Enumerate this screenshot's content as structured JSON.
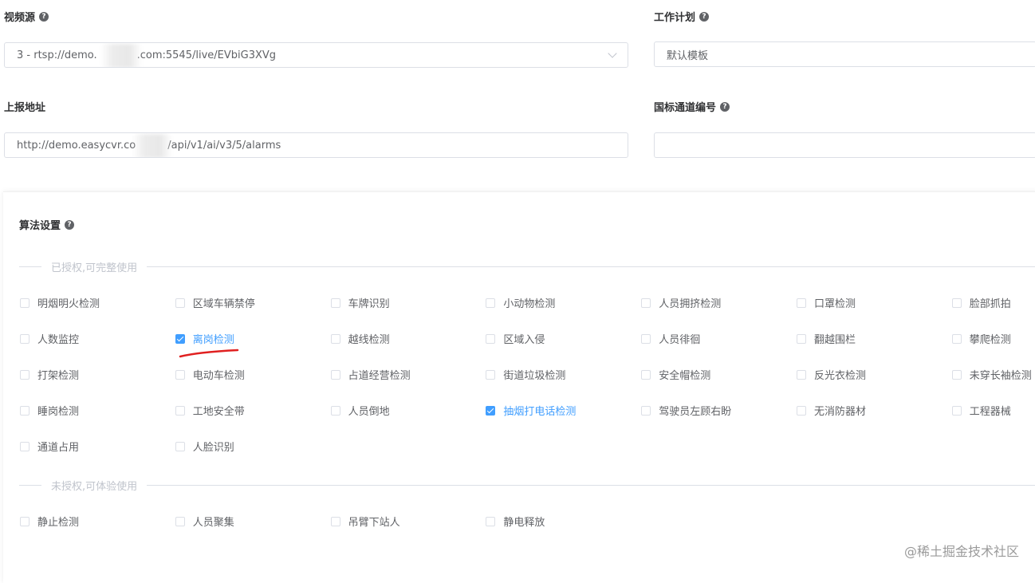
{
  "form": {
    "video_source": {
      "label": "视频源",
      "value_prefix": "3 - rtsp://demo.",
      "value_suffix": ".com:5545/live/EVbiG3XVg"
    },
    "work_plan": {
      "label": "工作计划",
      "value": "默认模板"
    },
    "report_url": {
      "label": "上报地址",
      "value_prefix": "http://demo.easycvr.co",
      "value_suffix": "/api/v1/ai/v3/5/alarms"
    },
    "gb_channel_id": {
      "label": "国标通道编号",
      "value": ""
    },
    "help_glyph": "?"
  },
  "algorithm": {
    "title": "算法设置",
    "authorized_title": "已授权,可完整使用",
    "unauthorized_title": "未授权,可体验使用",
    "authorized": [
      {
        "label": "明烟明火检测",
        "checked": false
      },
      {
        "label": "区域车辆禁停",
        "checked": false
      },
      {
        "label": "车牌识别",
        "checked": false
      },
      {
        "label": "小动物检测",
        "checked": false
      },
      {
        "label": "人员拥挤检测",
        "checked": false
      },
      {
        "label": "口罩检测",
        "checked": false
      },
      {
        "label": "脸部抓拍",
        "checked": false
      },
      {
        "label": "人数监控",
        "checked": false
      },
      {
        "label": "离岗检测",
        "checked": true
      },
      {
        "label": "越线检测",
        "checked": false
      },
      {
        "label": "区域入侵",
        "checked": false
      },
      {
        "label": "人员徘徊",
        "checked": false
      },
      {
        "label": "翻越围栏",
        "checked": false
      },
      {
        "label": "攀爬检测",
        "checked": false
      },
      {
        "label": "打架检测",
        "checked": false
      },
      {
        "label": "电动车检测",
        "checked": false
      },
      {
        "label": "占道经营检测",
        "checked": false
      },
      {
        "label": "街道垃圾检测",
        "checked": false
      },
      {
        "label": "安全帽检测",
        "checked": false
      },
      {
        "label": "反光衣检测",
        "checked": false
      },
      {
        "label": "未穿长袖检测",
        "checked": false
      },
      {
        "label": "睡岗检测",
        "checked": false
      },
      {
        "label": "工地安全带",
        "checked": false
      },
      {
        "label": "人员倒地",
        "checked": false
      },
      {
        "label": "抽烟打电话检测",
        "checked": true
      },
      {
        "label": "驾驶员左顾右盼",
        "checked": false
      },
      {
        "label": "无消防器材",
        "checked": false
      },
      {
        "label": "工程器械",
        "checked": false
      },
      {
        "label": "通道占用",
        "checked": false
      },
      {
        "label": "人脸识别",
        "checked": false
      }
    ],
    "unauthorized": [
      {
        "label": "静止检测",
        "checked": false
      },
      {
        "label": "人员聚集",
        "checked": false
      },
      {
        "label": "吊臂下站人",
        "checked": false
      },
      {
        "label": "静电释放",
        "checked": false
      }
    ]
  },
  "watermark": "@稀土掘金技术社区",
  "colors": {
    "accent": "#409eff",
    "annotation_underline": "#e02020"
  }
}
